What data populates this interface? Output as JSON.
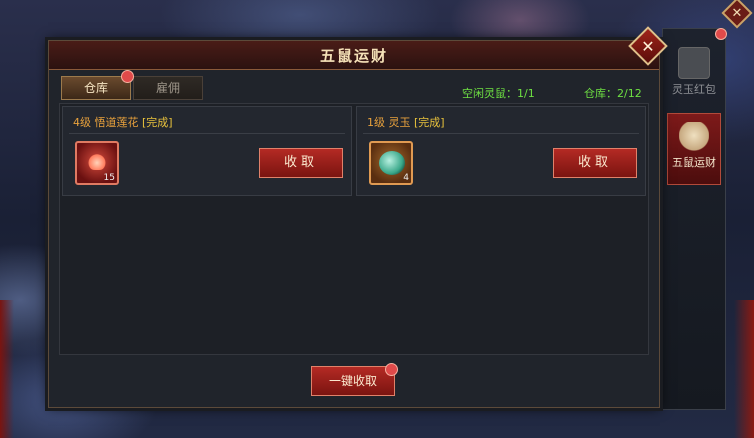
{
  "window": {
    "title": "五鼠运财",
    "close_icon": "close-icon"
  },
  "tabs": [
    {
      "label": "仓库",
      "active": true,
      "has_badge": true
    },
    {
      "label": "雇佣",
      "active": false,
      "has_badge": false
    }
  ],
  "stats": {
    "idle_rats": "空闲灵鼠：1/1",
    "storage": "仓库：2/12"
  },
  "cards": [
    {
      "level": "4级 悟道莲花",
      "status": "[完成]",
      "item_icon": "lotus-icon",
      "count": "15",
      "button": "收取"
    },
    {
      "level": "1级 灵玉",
      "status": "[完成]",
      "item_icon": "jade-icon",
      "count": "4",
      "button": "收取"
    }
  ],
  "collect_all": {
    "label": "一键收取",
    "has_badge": true
  },
  "side_tabs": [
    {
      "label": "灵玉红包",
      "active": false,
      "icon": "red-envelope-icon"
    },
    {
      "label": "五鼠运财",
      "active": true,
      "icon": "rat-icon"
    }
  ],
  "colors": {
    "accent_red": "#b42a24",
    "status_green": "#6ee043",
    "level_orange": "#e8a13c",
    "title_gold": "#f6e2b8"
  }
}
